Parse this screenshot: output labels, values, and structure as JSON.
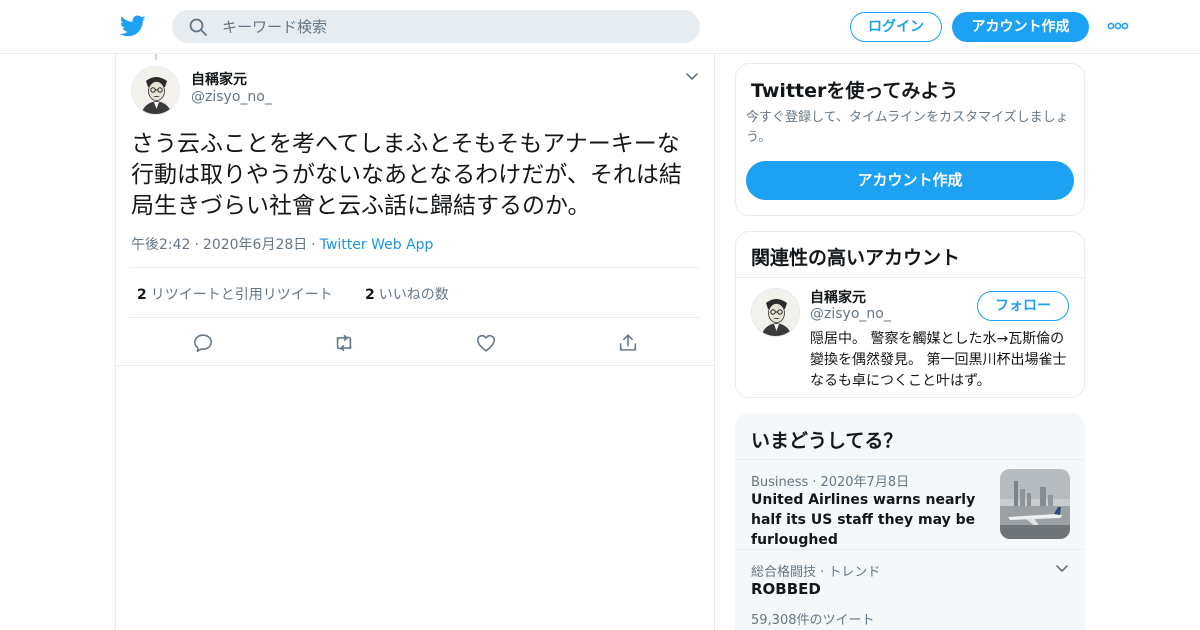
{
  "header": {
    "search_placeholder": "キーワード検索",
    "login_label": "ログイン",
    "signup_label": "アカウント作成"
  },
  "tweet": {
    "author_name": "自稱家元",
    "author_handle": "@zisyo_no_",
    "text": "さう云ふことを考へてしまふとそもそもアナーキーな行動は取りやうがないなあとなるわけだが、それは結局生きづらい社會と云ふ話に歸結するのか。",
    "time": "午後2:42",
    "separator": "·",
    "date": "2020年6月28日",
    "source": "Twitter Web App",
    "retweet_count": "2",
    "retweet_label": "リツイートと引用リツイート",
    "like_count": "2",
    "like_label": "いいねの数"
  },
  "signup_card": {
    "title": "Twitterを使ってみよう",
    "description": "今すぐ登録して、タイムラインをカスタマイズしましょう。",
    "button_label": "アカウント作成"
  },
  "related_card": {
    "title": "関連性の高いアカウント",
    "name": "自稱家元",
    "handle": "@zisyo_no_",
    "follow_label": "フォロー",
    "bio": "隠居中。 警察を觸媒とした水→瓦斯倫の變換を偶然發見。 第一回黒川杯出場雀士なるも卓につくこと叶はず。"
  },
  "trends_card": {
    "title": "いまどうしてる？",
    "item1": {
      "category": "Business",
      "separator": "·",
      "date": "2020年7月8日",
      "headline": "United Airlines warns nearly half its US staff they may be furloughed"
    },
    "item2": {
      "context": "総合格闘技 · トレンド",
      "name": "ROBBED",
      "count": "59,308件のツイート"
    }
  },
  "colors": {
    "accent": "#1da1f2",
    "link": "#1b95e0",
    "secondary_text": "#657786",
    "border": "#e6ecf0"
  },
  "icons": [
    "twitter-bird-icon",
    "search-icon",
    "more-dots-icon",
    "chevron-down-icon",
    "reply-icon",
    "retweet-icon",
    "like-heart-icon",
    "share-icon"
  ]
}
